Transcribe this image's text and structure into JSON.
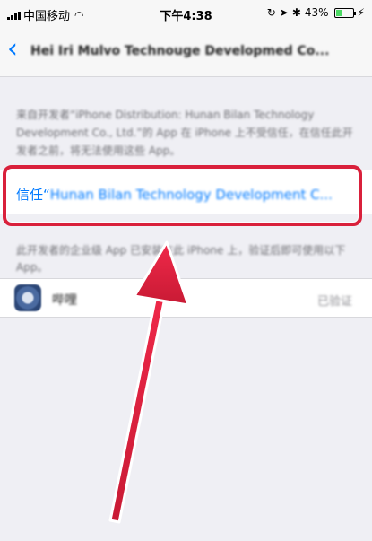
{
  "status_bar": {
    "carrier": "中国移动",
    "time": "下午4:38",
    "battery_percent": "43%",
    "battery_level": 0.43,
    "icons": [
      "signal-icon",
      "wifi-icon",
      "orientation-lock-icon",
      "location-icon",
      "bluetooth-icon",
      "battery-icon",
      "charging-icon"
    ]
  },
  "nav": {
    "back_icon": "chevron-left-icon",
    "title": "Hei Iri Mulvo Technouge Developmed Co..."
  },
  "description": {
    "text": "来自开发者“iPhone Distribution: Hunan Bilan Technology Development Co., Ltd.”的 App 在 iPhone 上不受信任，在信任此开发者之前，将无法使用这些 App。"
  },
  "trust": {
    "prefix": "信任“",
    "name": "Hunan Bilan Technology Development C..."
  },
  "footer": {
    "text": "此开发者的企业级 App 已安装在此 iPhone 上，验证后即可使用以下 App。"
  },
  "app": {
    "name": "哔哩",
    "status": "已验证"
  },
  "colors": {
    "accent": "#007aff",
    "highlight": "#d9203b",
    "arrow": "#e8233f",
    "background": "#efeff4"
  }
}
